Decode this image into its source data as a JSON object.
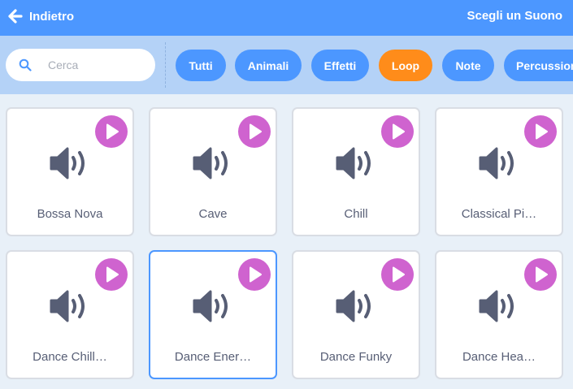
{
  "header": {
    "back_label": "Indietro",
    "title": "Scegli un Suono",
    "icons": {
      "back": "arrow-left-icon"
    }
  },
  "search": {
    "placeholder": "Cerca",
    "value": "",
    "icon": "search-icon"
  },
  "filters": [
    {
      "label": "Tutti",
      "active": false
    },
    {
      "label": "Animali",
      "active": false
    },
    {
      "label": "Effetti",
      "active": false
    },
    {
      "label": "Loop",
      "active": true
    },
    {
      "label": "Note",
      "active": false
    },
    {
      "label": "Percussioni",
      "active": false
    }
  ],
  "sounds": [
    {
      "label": "Bossa Nova",
      "selected": false
    },
    {
      "label": "Cave",
      "selected": false
    },
    {
      "label": "Chill",
      "selected": false
    },
    {
      "label": "Classical Pi…",
      "selected": false
    },
    {
      "label": "Dance Chill…",
      "selected": false
    },
    {
      "label": "Dance Ener…",
      "selected": true
    },
    {
      "label": "Dance Funky",
      "selected": false
    },
    {
      "label": "Dance Hea…",
      "selected": false
    }
  ],
  "colors": {
    "header": "#4c97ff",
    "filter_bar": "#b4d2f7",
    "chip": "#4c97ff",
    "chip_active": "#ff8c1a",
    "play_button": "#cf63cf",
    "speaker_icon": "#575e75",
    "grid_background": "#e8f0f8",
    "selected_border": "#4c97ff"
  }
}
